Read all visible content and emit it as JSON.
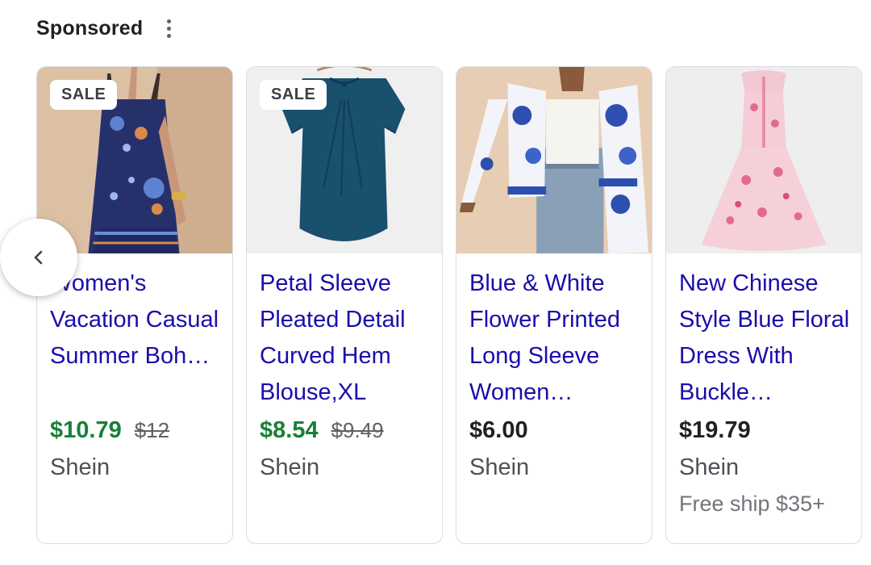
{
  "header": {
    "title": "Sponsored",
    "more_icon": "more-vert-icon"
  },
  "carousel": {
    "prev_icon": "chevron-left-icon"
  },
  "products": [
    {
      "badge": "SALE",
      "title": "Women's Vacation Casual Summer Boh…",
      "price": "$10.79",
      "original_price": "$12",
      "merchant": "Shein",
      "shipping": "",
      "on_sale": true
    },
    {
      "badge": "SALE",
      "title": "Petal Sleeve Pleated Detail Curved Hem Blouse,XL",
      "price": "$8.54",
      "original_price": "$9.49",
      "merchant": "Shein",
      "shipping": "",
      "on_sale": true
    },
    {
      "badge": "",
      "title": "Blue & White Flower Printed Long Sleeve Women…",
      "price": "$6.00",
      "original_price": "",
      "merchant": "Shein",
      "shipping": "",
      "on_sale": false
    },
    {
      "badge": "",
      "title": "New Chinese Style Blue Floral Dress With Buckle…",
      "price": "$19.79",
      "original_price": "",
      "merchant": "Shein",
      "shipping": "Free ship $35+",
      "on_sale": false
    }
  ],
  "colors": {
    "link": "#1a0dab",
    "sale_price": "#188038",
    "border": "#dadce0"
  }
}
